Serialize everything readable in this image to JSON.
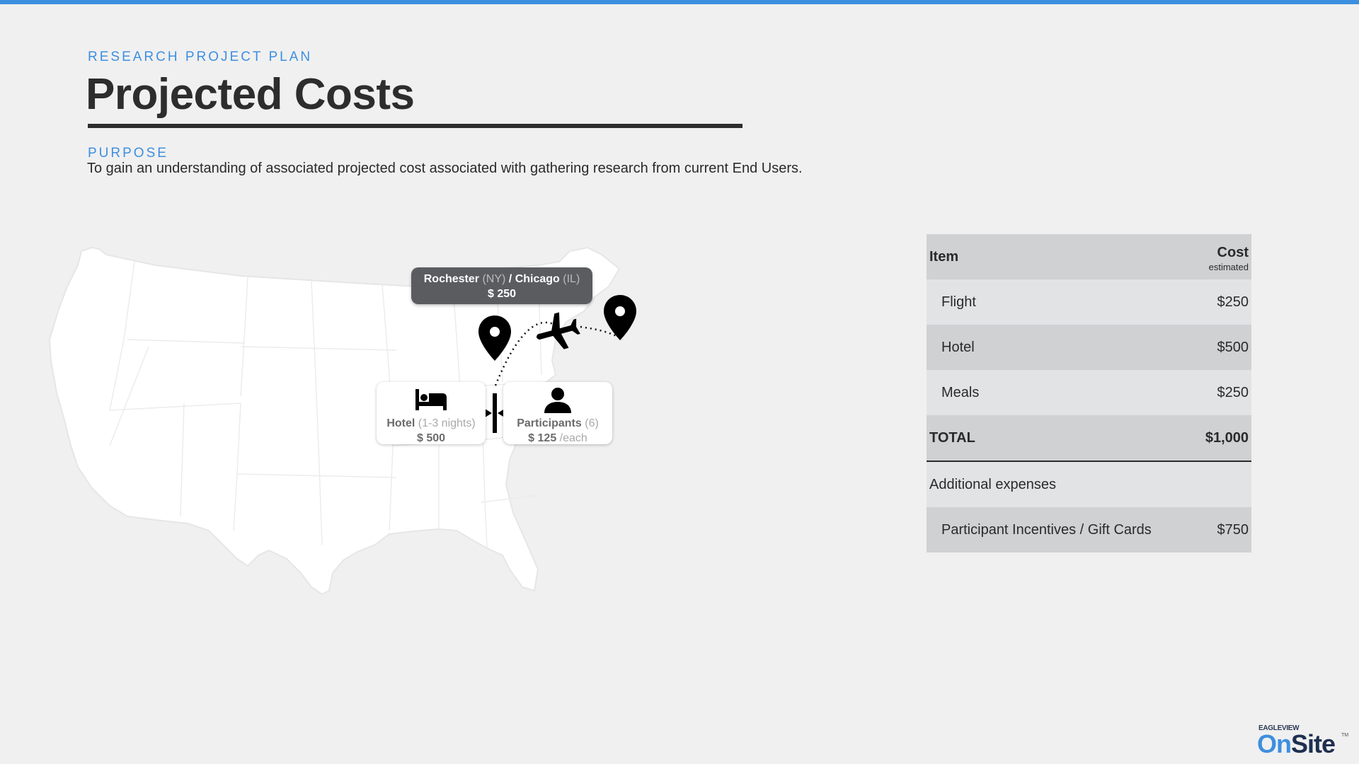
{
  "header": {
    "eyebrow": "RESEARCH PROJECT PLAN",
    "title": "Projected Costs",
    "purpose_label": "PURPOSE",
    "purpose_text": "To gain an understanding of associated projected cost associated with gathering research from current End Users."
  },
  "map": {
    "route_bubble": {
      "origin": "Rochester",
      "origin_state": "(NY)",
      "separator": "/",
      "destination": "Chicago",
      "destination_state": "(IL)",
      "price": "$ 250"
    },
    "hotel_card": {
      "label": "Hotel",
      "detail": "(1-3 nights)",
      "price": "$ 500"
    },
    "participants_card": {
      "label": "Participants",
      "detail": "(6)",
      "price": "$ 125",
      "unit": "/each"
    }
  },
  "cost_table": {
    "header_item": "Item",
    "header_cost": "Cost",
    "header_cost_note": "estimated",
    "rows": [
      {
        "item": "Flight",
        "cost": "$250"
      },
      {
        "item": "Hotel",
        "cost": "$500"
      },
      {
        "item": "Meals",
        "cost": "$250"
      }
    ],
    "total_label": "TOTAL",
    "total_value": "$1,000",
    "additional_label": "Additional expenses",
    "additional_rows": [
      {
        "item": "Participant Incentives / Gift Cards",
        "cost": "$750"
      }
    ]
  },
  "logo": {
    "small": "EAGLEVIEW",
    "on": "On",
    "site": "Site",
    "tm": "TM"
  },
  "colors": {
    "accent": "#3d8fe0",
    "background": "#f0f0f0",
    "table_dark": "#cfd1d3",
    "table_light": "#e2e3e4"
  }
}
